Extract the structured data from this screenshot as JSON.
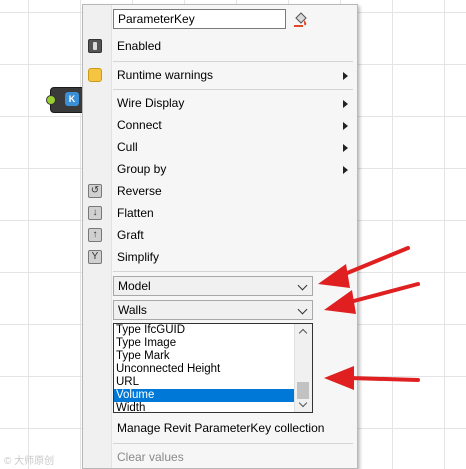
{
  "menu": {
    "key_input_value": "ParameterKey",
    "items": {
      "enabled": "Enabled",
      "runtime_warnings": "Runtime warnings",
      "wire_display": "Wire Display",
      "connect": "Connect",
      "cull": "Cull",
      "group_by": "Group by",
      "reverse": "Reverse",
      "flatten": "Flatten",
      "graft": "Graft",
      "simplify": "Simplify",
      "manage": "Manage Revit ParameterKey collection",
      "clear": "Clear values"
    },
    "combo_model": "Model",
    "combo_category": "Walls",
    "list_items": [
      "Type IfcGUID",
      "Type Image",
      "Type Mark",
      "Unconnected Height",
      "URL",
      "Volume",
      "Width"
    ],
    "list_selected": "Volume"
  },
  "canvas_node": {
    "badge": "K"
  },
  "colors": {
    "selection": "#0078d7",
    "annotation_arrow": "#e02020"
  },
  "watermark": "© 大师原创"
}
